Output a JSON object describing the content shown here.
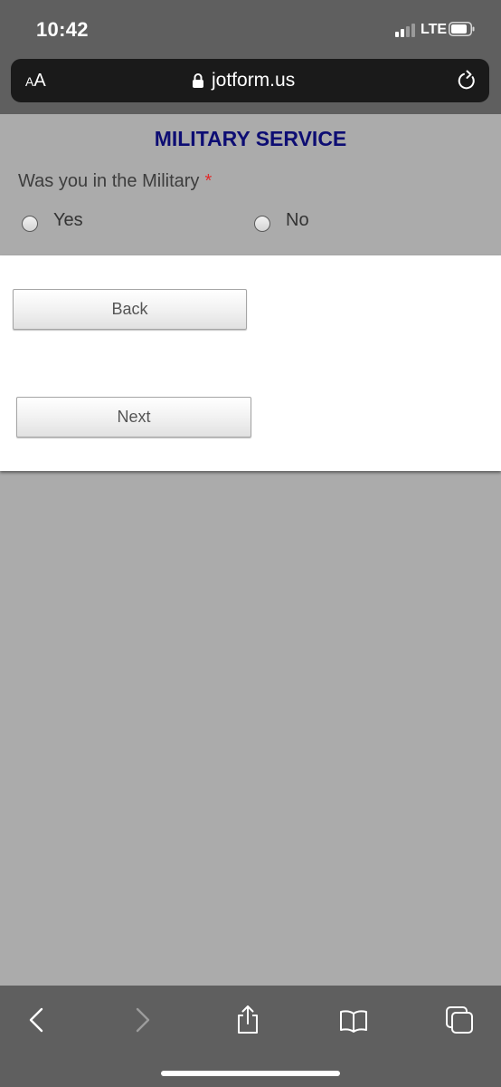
{
  "status_bar": {
    "time": "10:42",
    "network": "LTE",
    "icons": [
      "signal-icon",
      "battery-icon"
    ]
  },
  "browser": {
    "text_size_button": "AA",
    "url": "jotform.us",
    "icons": [
      "lock-icon",
      "reload-icon"
    ]
  },
  "form": {
    "title": "MILITARY SERVICE",
    "question": "Was you in the Military",
    "required_mark": "*",
    "options": [
      {
        "label": "Yes"
      },
      {
        "label": "No"
      }
    ],
    "back_label": "Back",
    "next_label": "Next"
  },
  "toolbar": {
    "icons": [
      "back-arrow-icon",
      "forward-arrow-icon",
      "share-icon",
      "bookmarks-icon",
      "tabs-icon"
    ]
  },
  "colors": {
    "title": "#0d0d73",
    "required": "#e02b2b",
    "page_background": "#ababab",
    "browser_chrome": "#5f5f5f"
  }
}
